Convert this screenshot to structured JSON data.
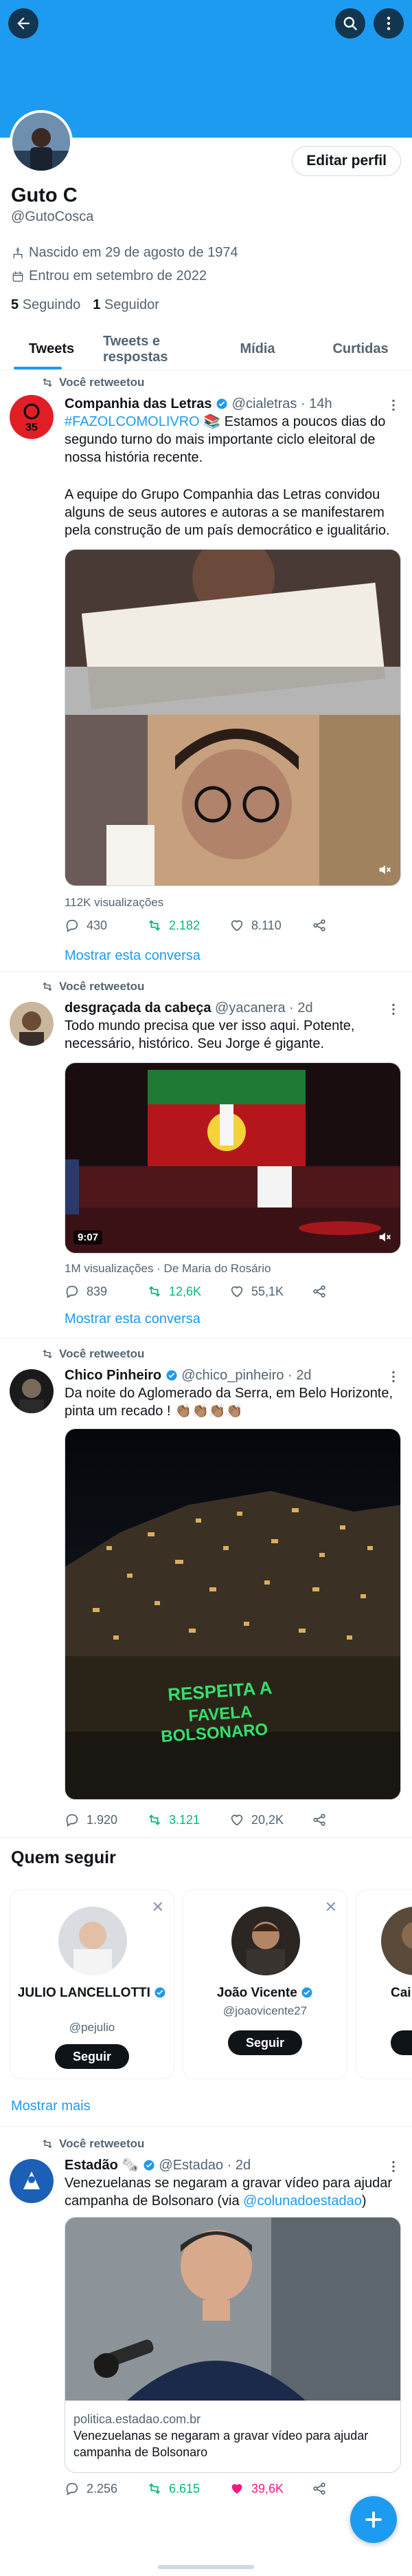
{
  "profile": {
    "name": "Guto C",
    "handle": "@GutoCosca",
    "edit_label": "Editar perfil",
    "born": "Nascido em 29 de agosto de 1974",
    "joined": "Entrou em setembro de 2022",
    "following_count": "5",
    "following_label": "Seguindo",
    "followers_count": "1",
    "followers_label": "Seguidor"
  },
  "tabs": [
    "Tweets",
    "Tweets e respostas",
    "Mídia",
    "Curtidas"
  ],
  "retweet_label": "Você retweetou",
  "tweets": [
    {
      "author": "Companhia das Letras",
      "handle": "@cialetras",
      "time": "14h",
      "hashtag": "#FAZOLCOMOLIVRO",
      "text_after_hashtag": " 📚 Estamos a poucos dias do segundo turno do mais importante ciclo eleitoral de nossa história recente.",
      "text2": "A equipe do Grupo Companhia das Letras convidou alguns de seus autores e autoras a se manifestarem pela construção de um país democrático e igualitário.",
      "views": "112K visualizações",
      "replies": "430",
      "retweets": "2.182",
      "likes": "8.110",
      "show_conversation": "Mostrar esta conversa"
    },
    {
      "author": "desgraçada da cabeça",
      "handle": "@yacanera",
      "time": "2d",
      "text": "Todo mundo precisa que ver isso aqui. Potente, necessário, histórico. Seu Jorge é gigante.",
      "video_time": "9:07",
      "views": "1M visualizações · De Maria do Rosário",
      "replies": "839",
      "retweets": "12,6K",
      "likes": "55,1K",
      "show_conversation": "Mostrar esta conversa"
    },
    {
      "author": "Chico Pinheiro",
      "handle": "@chico_pinheiro",
      "time": "2d",
      "text": "Da noite do Aglomerado da Serra, em Belo Horizonte, pinta um recado ! 👏🏽👏🏽👏🏽👏🏽",
      "image_text": "RESPEITA A FAVELA BOLSONARO",
      "replies": "1.920",
      "retweets": "3.121",
      "likes": "20,2K"
    },
    {
      "author": "Estadão",
      "author_badges": "🗞️",
      "handle": "@Estadao",
      "time": "2d",
      "text": "Venezuelanas se negaram a gravar vídeo para ajudar campanha de Bolsonaro (via ",
      "mention": "@colunadoestadao",
      "text_end": ")",
      "card_domain": "politica.estadao.com.br",
      "card_title": "Venezuelanas se negaram a gravar vídeo para ajudar campanha de Bolsonaro",
      "replies": "2.256",
      "retweets": "6.615",
      "likes": "39,6K"
    }
  ],
  "who_to_follow": {
    "title": "Quem seguir",
    "follow_label": "Seguir",
    "show_more": "Mostrar mais",
    "users": [
      {
        "name": "JULIO LANCELLOTTI",
        "handle": "@pejulio"
      },
      {
        "name": "João Vicente",
        "handle": "@joaovicente27"
      },
      {
        "name": "Cai",
        "handle": ""
      }
    ]
  },
  "colors": {
    "accent": "#1d9bf0",
    "retweet": "#00ba7c",
    "like": "#f91880"
  },
  "icons": [
    "back-arrow-icon",
    "search-icon",
    "more-vertical-icon",
    "calendar-icon",
    "birthday-icon",
    "retweet-icon",
    "reply-icon",
    "like-icon",
    "share-icon",
    "verified-icon",
    "compose-icon"
  ]
}
